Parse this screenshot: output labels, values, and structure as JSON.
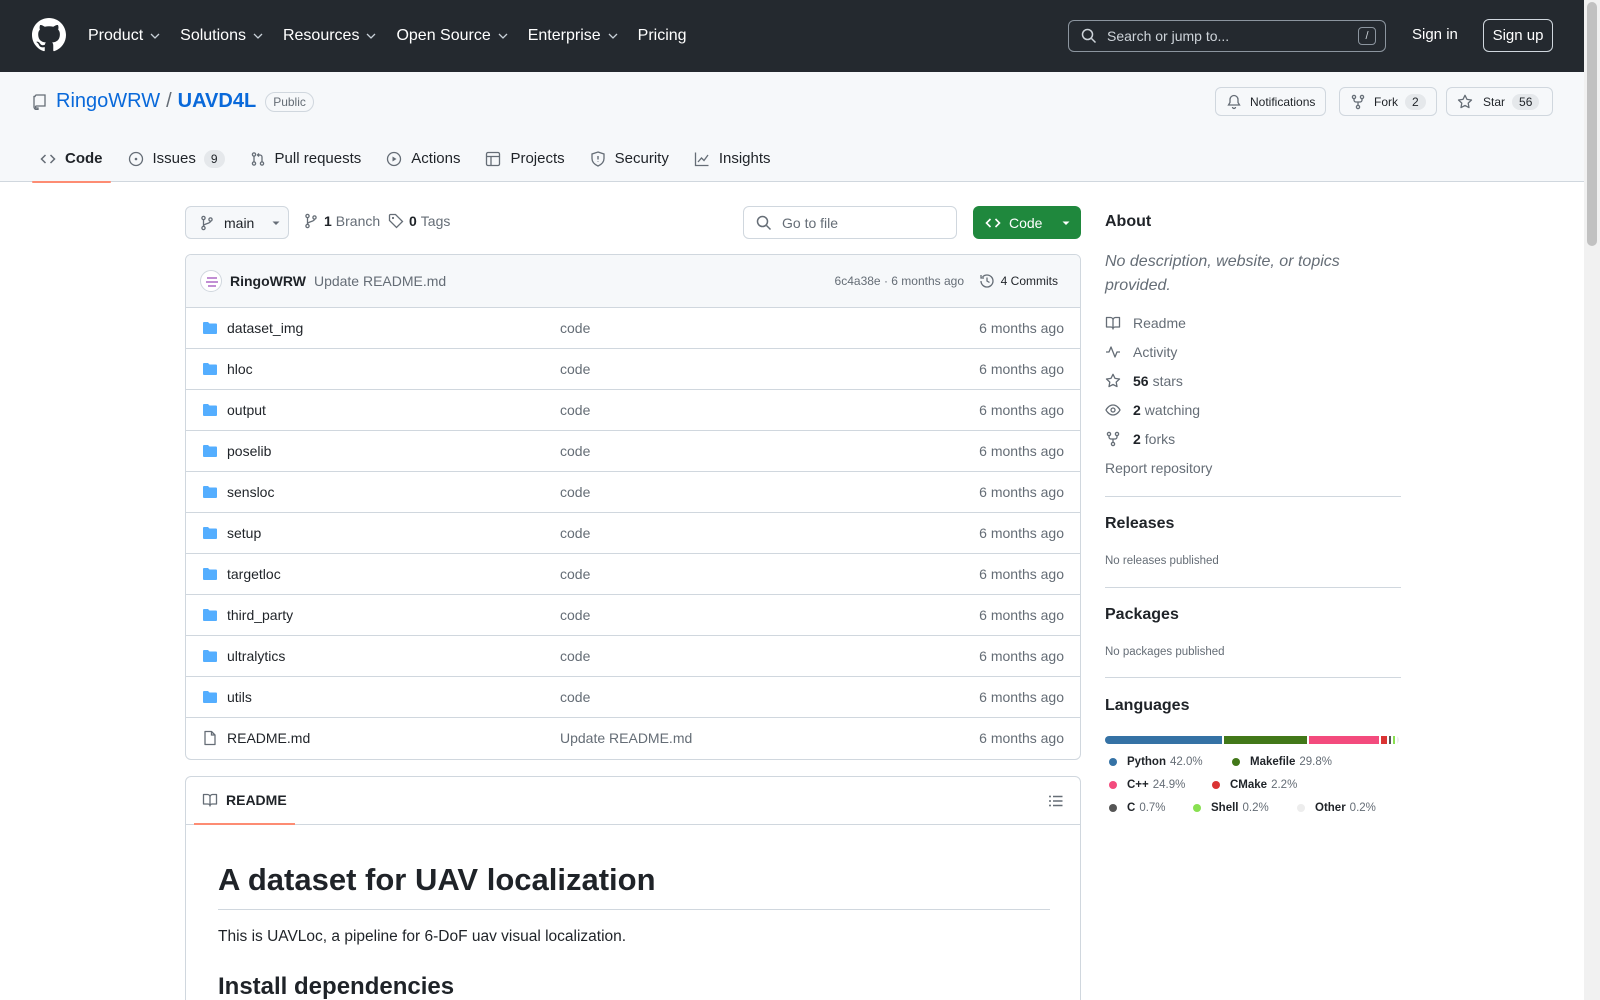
{
  "header": {
    "nav": [
      {
        "label": "Product",
        "dropdown": true
      },
      {
        "label": "Solutions",
        "dropdown": true
      },
      {
        "label": "Resources",
        "dropdown": true
      },
      {
        "label": "Open Source",
        "dropdown": true
      },
      {
        "label": "Enterprise",
        "dropdown": true
      },
      {
        "label": "Pricing",
        "dropdown": false
      }
    ],
    "search_placeholder": "Search or jump to...",
    "search_shortcut": "/",
    "sign_in": "Sign in",
    "sign_up": "Sign up"
  },
  "repo": {
    "owner": "RingoWRW",
    "name": "UAVD4L",
    "visibility": "Public",
    "notifications_label": "Notifications",
    "fork_label": "Fork",
    "fork_count": "2",
    "star_label": "Star",
    "star_count": "56"
  },
  "tabs": [
    {
      "label": "Code",
      "icon": "code-icon",
      "active": true
    },
    {
      "label": "Issues",
      "icon": "issue-icon",
      "count": "9"
    },
    {
      "label": "Pull requests",
      "icon": "pull-request-icon"
    },
    {
      "label": "Actions",
      "icon": "play-icon"
    },
    {
      "label": "Projects",
      "icon": "table-icon"
    },
    {
      "label": "Security",
      "icon": "shield-icon"
    },
    {
      "label": "Insights",
      "icon": "graph-icon"
    }
  ],
  "toolbar": {
    "branch": "main",
    "branch_count": "1",
    "branch_label": "Branch",
    "tag_count": "0",
    "tag_label": "Tags",
    "go_to_file": "Go to file",
    "code_button": "Code"
  },
  "latest_commit": {
    "author": "RingoWRW",
    "message": "Update README.md",
    "hash": "6c4a38e",
    "sep": "·",
    "time": "6 months ago",
    "commits": "4 Commits"
  },
  "files": [
    {
      "name": "dataset_img",
      "type": "dir",
      "commit": "code",
      "time": "6 months ago"
    },
    {
      "name": "hloc",
      "type": "dir",
      "commit": "code",
      "time": "6 months ago"
    },
    {
      "name": "output",
      "type": "dir",
      "commit": "code",
      "time": "6 months ago"
    },
    {
      "name": "poselib",
      "type": "dir",
      "commit": "code",
      "time": "6 months ago"
    },
    {
      "name": "sensloc",
      "type": "dir",
      "commit": "code",
      "time": "6 months ago"
    },
    {
      "name": "setup",
      "type": "dir",
      "commit": "code",
      "time": "6 months ago"
    },
    {
      "name": "targetloc",
      "type": "dir",
      "commit": "code",
      "time": "6 months ago"
    },
    {
      "name": "third_party",
      "type": "dir",
      "commit": "code",
      "time": "6 months ago"
    },
    {
      "name": "ultralytics",
      "type": "dir",
      "commit": "code",
      "time": "6 months ago"
    },
    {
      "name": "utils",
      "type": "dir",
      "commit": "code",
      "time": "6 months ago"
    },
    {
      "name": "README.md",
      "type": "file",
      "commit": "Update README.md",
      "time": "6 months ago"
    }
  ],
  "readme": {
    "tab_label": "README",
    "h1": "A dataset for UAV localization",
    "p1": "This is UAVLoc, a pipeline for 6-DoF uav visual localization.",
    "h2": "Install dependencies"
  },
  "about": {
    "title": "About",
    "description": "No description, website, or topics provided.",
    "readme": "Readme",
    "activity": "Activity",
    "stars_count": "56",
    "stars_label": "stars",
    "watching_count": "2",
    "watching_label": "watching",
    "forks_count": "2",
    "forks_label": "forks",
    "report": "Report repository"
  },
  "releases": {
    "title": "Releases",
    "text": "No releases published"
  },
  "packages": {
    "title": "Packages",
    "text": "No packages published"
  },
  "languages": {
    "title": "Languages",
    "items": [
      {
        "name": "Python",
        "percent": "42.0%",
        "value": 42.0,
        "color": "#3572A5"
      },
      {
        "name": "Makefile",
        "percent": "29.8%",
        "value": 29.8,
        "color": "#427819"
      },
      {
        "name": "C++",
        "percent": "24.9%",
        "value": 24.9,
        "color": "#f34b7d"
      },
      {
        "name": "CMake",
        "percent": "2.2%",
        "value": 2.2,
        "color": "#DA3434"
      },
      {
        "name": "C",
        "percent": "0.7%",
        "value": 0.7,
        "color": "#555555"
      },
      {
        "name": "Shell",
        "percent": "0.2%",
        "value": 0.2,
        "color": "#89e051"
      },
      {
        "name": "Other",
        "percent": "0.2%",
        "value": 0.2,
        "color": "#ededed"
      }
    ]
  }
}
